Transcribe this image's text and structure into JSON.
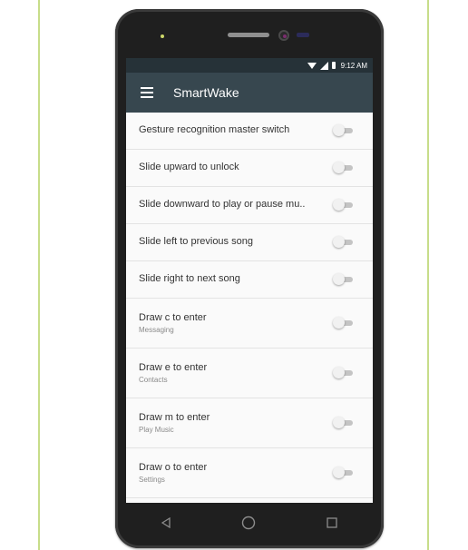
{
  "status_bar": {
    "time": "9:12 AM",
    "icons": [
      "wifi-icon",
      "signal-icon",
      "battery-icon"
    ]
  },
  "app_bar": {
    "title": "SmartWake",
    "menu_icon": "menu-icon"
  },
  "settings": [
    {
      "title": "Gesture recognition master switch",
      "subtitle": "",
      "enabled": false
    },
    {
      "title": "Slide upward to unlock",
      "subtitle": "",
      "enabled": false
    },
    {
      "title": "Slide downward to play or pause mu..",
      "subtitle": "",
      "enabled": false
    },
    {
      "title": "Slide left to previous song",
      "subtitle": "",
      "enabled": false
    },
    {
      "title": "Slide right to next song",
      "subtitle": "",
      "enabled": false
    },
    {
      "title": "Draw c to enter",
      "subtitle": "Messaging",
      "enabled": false
    },
    {
      "title": "Draw e to enter",
      "subtitle": "Contacts",
      "enabled": false
    },
    {
      "title": "Draw m to enter",
      "subtitle": "Play Music",
      "enabled": false
    },
    {
      "title": "Draw o to enter",
      "subtitle": "Settings",
      "enabled": false
    }
  ],
  "nav_bar": {
    "icons": [
      "back-icon",
      "home-icon",
      "recents-icon"
    ]
  },
  "colors": {
    "status_bar": "#263238",
    "app_bar": "#37474f",
    "switch_off_track": "#c4c4c4",
    "switch_off_thumb": "#f1f1f1"
  }
}
